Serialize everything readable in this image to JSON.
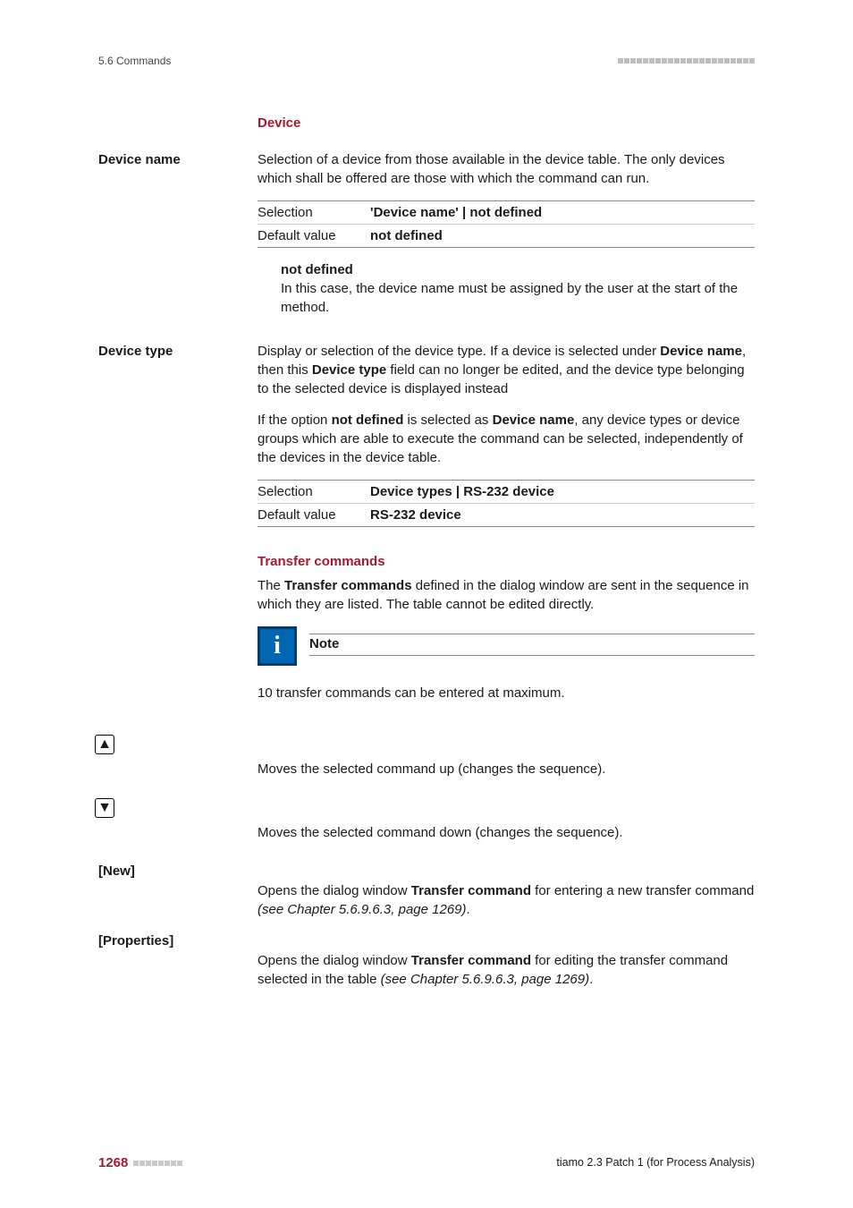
{
  "header": {
    "section": "5.6 Commands"
  },
  "device": {
    "heading": "Device",
    "name": {
      "label": "Device name",
      "desc": "Selection of a device from those available in the device table. The only devices which shall be offered are those with which the command can run.",
      "spec": {
        "selection_label": "Selection",
        "selection_value": "'Device name' | not defined",
        "default_label": "Default value",
        "default_value": "not defined"
      },
      "notdef_title": "not defined",
      "notdef_body": "In this case, the device name must be assigned by the user at the start of the method."
    },
    "type": {
      "label": "Device type",
      "p1_a": "Display or selection of the device type. If a device is selected under ",
      "p1_b": "Device name",
      "p1_c": ", then this ",
      "p1_d": "Device type",
      "p1_e": " field can no longer be edited, and the device type belonging to the selected device is displayed instead",
      "p2_a": "If the option ",
      "p2_b": "not defined",
      "p2_c": " is selected as ",
      "p2_d": "Device name",
      "p2_e": ", any device types or device groups which are able to execute the command can be selected, independently of the devices in the device table.",
      "spec": {
        "selection_label": "Selection",
        "selection_value": "Device types | RS-232 device",
        "default_label": "Default value",
        "default_value": "RS-232 device"
      }
    }
  },
  "transfer": {
    "heading": "Transfer commands",
    "intro_a": "The ",
    "intro_b": "Transfer commands",
    "intro_c": " defined in the dialog window are sent in the sequence in which they are listed. The table cannot be edited directly.",
    "note_title": "Note",
    "note_body": "10 transfer commands can be entered at maximum.",
    "up_desc": "Moves the selected command up (changes the sequence).",
    "down_desc": "Moves the selected command down (changes the sequence).",
    "new_label": "[New]",
    "new_a": "Opens the dialog window ",
    "new_b": "Transfer command",
    "new_c": " for entering a new transfer command ",
    "new_ref": "(see Chapter 5.6.9.6.3, page 1269)",
    "new_end": ".",
    "prop_label": "[Properties]",
    "prop_a": "Opens the dialog window ",
    "prop_b": "Transfer command",
    "prop_c": " for editing the transfer command selected in the table ",
    "prop_ref": "(see Chapter 5.6.9.6.3, page 1269)",
    "prop_end": "."
  },
  "footer": {
    "page": "1268",
    "product": "tiamo 2.3 Patch 1 (for Process Analysis)"
  }
}
